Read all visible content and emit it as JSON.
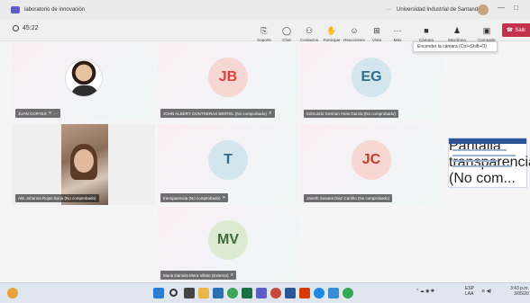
{
  "window": {
    "title": "laboratorio de innovación",
    "more": "···",
    "org": "Universidad Industrial de Santander",
    "minimize": "—",
    "maximize": "□"
  },
  "toolbar": {
    "timer": "45:22",
    "items": [
      {
        "label": "Soporte",
        "icon": "⎘"
      },
      {
        "label": "Chat",
        "icon": "◯"
      },
      {
        "label": "Contactos",
        "icon": "⚇"
      },
      {
        "label": "Participar",
        "icon": "✋"
      },
      {
        "label": "Reacciones",
        "icon": "☺"
      },
      {
        "label": "Vista",
        "icon": "⊞"
      },
      {
        "label": "Más",
        "icon": "···"
      },
      {
        "label": "Cámara",
        "icon": "■"
      },
      {
        "label": "Micrófono",
        "icon": "♟"
      },
      {
        "label": "Compartir",
        "icon": "▣"
      }
    ],
    "leave_label": "Salir"
  },
  "tooltip": "Encender la cámara (Ctrl+Shift+O)",
  "participants": [
    {
      "name": "JUAN CORTES",
      "extra": "···",
      "type": "photo"
    },
    {
      "initials": "JB",
      "name": "JOHN ALBERT CONTRERAS BERTEL (No comprobado)",
      "color": "#d9423f",
      "bg": "#f6d7d2"
    },
    {
      "initials": "EG",
      "name": "Edmundo German Arias Garcia (No comprobado)",
      "color": "#2f6b8a",
      "bg": "#d3e6ee"
    },
    {
      "name": "Alis Johanna Rojas Borja (No comprobado)",
      "type": "video"
    },
    {
      "initials": "T",
      "name": "transparencia (No comprobado)",
      "color": "#2f6b8a",
      "bg": "#d3e6ee"
    },
    {
      "initials": "JC",
      "name": "Janeth Susana Diaz Carrillo (No comprobado)",
      "color": "#c13d2b",
      "bg": "#f6d7d2"
    },
    {
      "name": "Pantalla transparencia (No com...",
      "type": "screen"
    },
    {
      "initials": "MV",
      "name": "Maria Daniela Mera Villate (Externo)",
      "color": "#3f6b3a",
      "bg": "#dcead2"
    }
  ],
  "taskbar": {
    "lang": "ESP\nLAA",
    "time": "3:43 p.m.",
    "date": "3/05/20"
  },
  "colors": {
    "accent": "#5b5fc7",
    "leave": "#c4314b"
  }
}
